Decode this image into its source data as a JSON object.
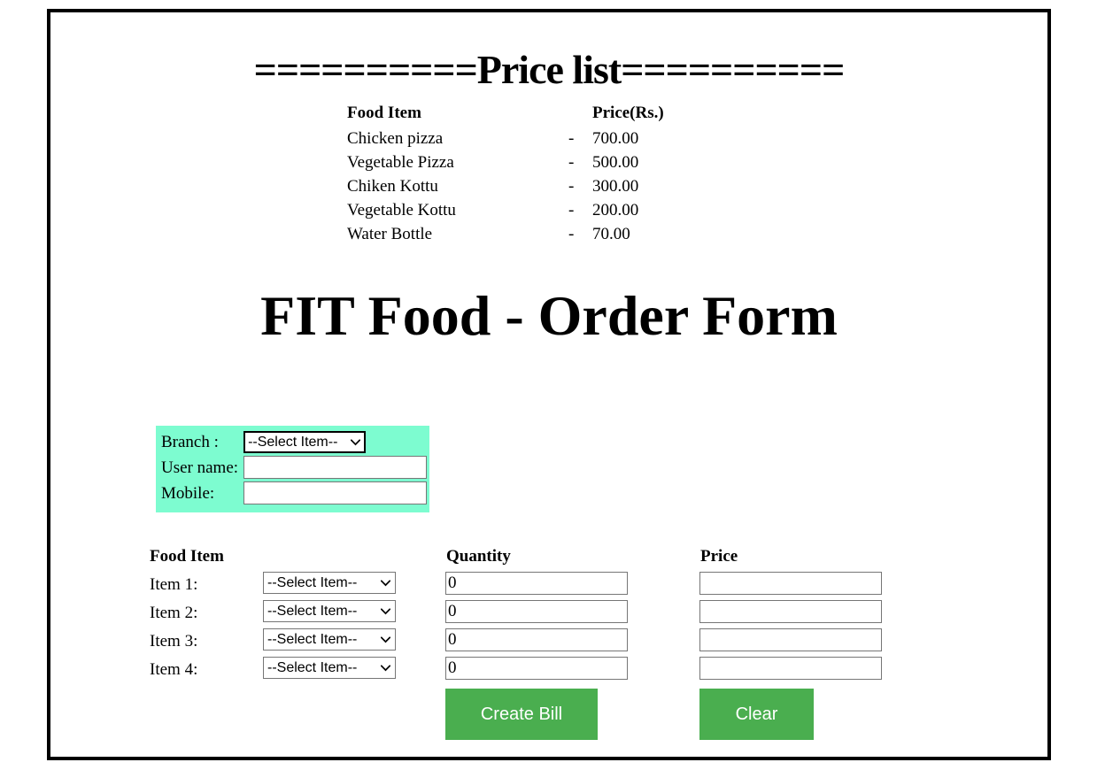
{
  "price_list": {
    "banner": "==========Price list==========",
    "headers": {
      "item": "Food Item",
      "price": "Price(Rs.)"
    },
    "rows": [
      {
        "name": "Chicken pizza",
        "dash": "-",
        "price": "700.00"
      },
      {
        "name": "Vegetable Pizza",
        "dash": "-",
        "price": "500.00"
      },
      {
        "name": "Chiken Kottu",
        "dash": "-",
        "price": "300.00"
      },
      {
        "name": "Vegetable Kottu",
        "dash": "-",
        "price": "200.00"
      },
      {
        "name": "Water Bottle",
        "dash": "-",
        "price": "70.00"
      }
    ]
  },
  "form": {
    "title": "FIT Food - Order Form",
    "customer": {
      "branch_label": "Branch :",
      "branch_value": "--Select Item--",
      "branch_options": [
        "--Select Item--"
      ],
      "username_label": "User name:",
      "username_value": "",
      "username_placeholder": "",
      "mobile_label": "Mobile:",
      "mobile_value": "",
      "mobile_placeholder": ""
    },
    "columns": {
      "food_item": "Food Item",
      "quantity": "Quantity",
      "price": "Price"
    },
    "items": [
      {
        "label": "Item 1:",
        "selected": "--Select Item--",
        "quantity": "0",
        "price": ""
      },
      {
        "label": "Item 2:",
        "selected": "--Select Item--",
        "quantity": "0",
        "price": ""
      },
      {
        "label": "Item 3:",
        "selected": "--Select Item--",
        "quantity": "0",
        "price": ""
      },
      {
        "label": "Item 4:",
        "selected": "--Select Item--",
        "quantity": "0",
        "price": ""
      }
    ],
    "item_options": [
      "--Select Item--"
    ],
    "buttons": {
      "create_bill": "Create Bill",
      "clear": "Clear"
    }
  },
  "colors": {
    "panel_background": "#7dfcd0",
    "button_green": "#4aae4f",
    "button_text": "#ffffff",
    "page_border": "#000000",
    "text": "#000000"
  }
}
